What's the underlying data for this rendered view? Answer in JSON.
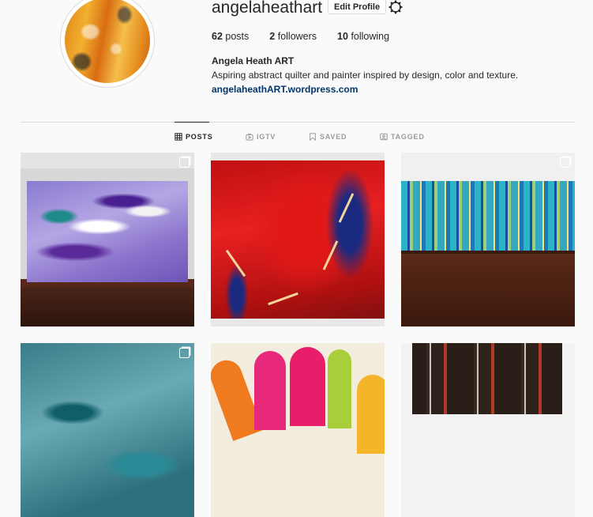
{
  "profile": {
    "username": "angelaheathart",
    "edit_label": "Edit Profile",
    "stats": [
      {
        "count": "62",
        "label": "posts"
      },
      {
        "count": "2",
        "label": "followers"
      },
      {
        "count": "10",
        "label": "following"
      }
    ],
    "full_name": "Angela Heath ART",
    "bio": "Aspiring abstract quilter and painter inspired by design, color and texture.",
    "website": "angelaheathART.wordpress.com"
  },
  "tabs": [
    {
      "label": "POSTS",
      "icon": "grid-icon",
      "active": true
    },
    {
      "label": "IGTV",
      "icon": "tv-icon",
      "active": false
    },
    {
      "label": "SAVED",
      "icon": "bookmark-icon",
      "active": false
    },
    {
      "label": "TAGGED",
      "icon": "tag-icon",
      "active": false
    }
  ],
  "colors": {
    "link": "#003569",
    "text": "#262626",
    "muted": "#999999",
    "border": "#dbdbdb",
    "background": "#fafafa"
  }
}
